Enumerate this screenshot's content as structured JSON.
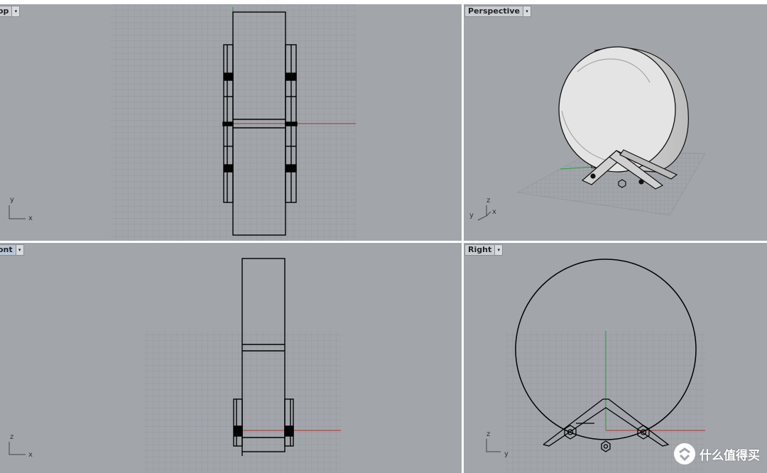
{
  "viewports": {
    "top": {
      "label": "Top",
      "label_visible": "op",
      "axes": {
        "x": "x",
        "y": "y"
      }
    },
    "perspective": {
      "label": "Perspective",
      "axes": {
        "x": "x",
        "y": "y",
        "z": "z"
      }
    },
    "front": {
      "label": "Front",
      "label_visible": "ont",
      "axes": {
        "x": "x",
        "z": "z"
      }
    },
    "right": {
      "label": "Right",
      "axes": {
        "y": "y",
        "z": "z"
      }
    }
  },
  "dropdown_glyph": "▾",
  "watermark": {
    "text": "什么值得买"
  },
  "colors": {
    "viewport_bg": "#a2a6ab",
    "grid": "#8e9297",
    "axis_x": "#b03030",
    "axis_y": "#2a9a3a",
    "geometry": "#000000",
    "active_tab": "#b9c6d8"
  }
}
